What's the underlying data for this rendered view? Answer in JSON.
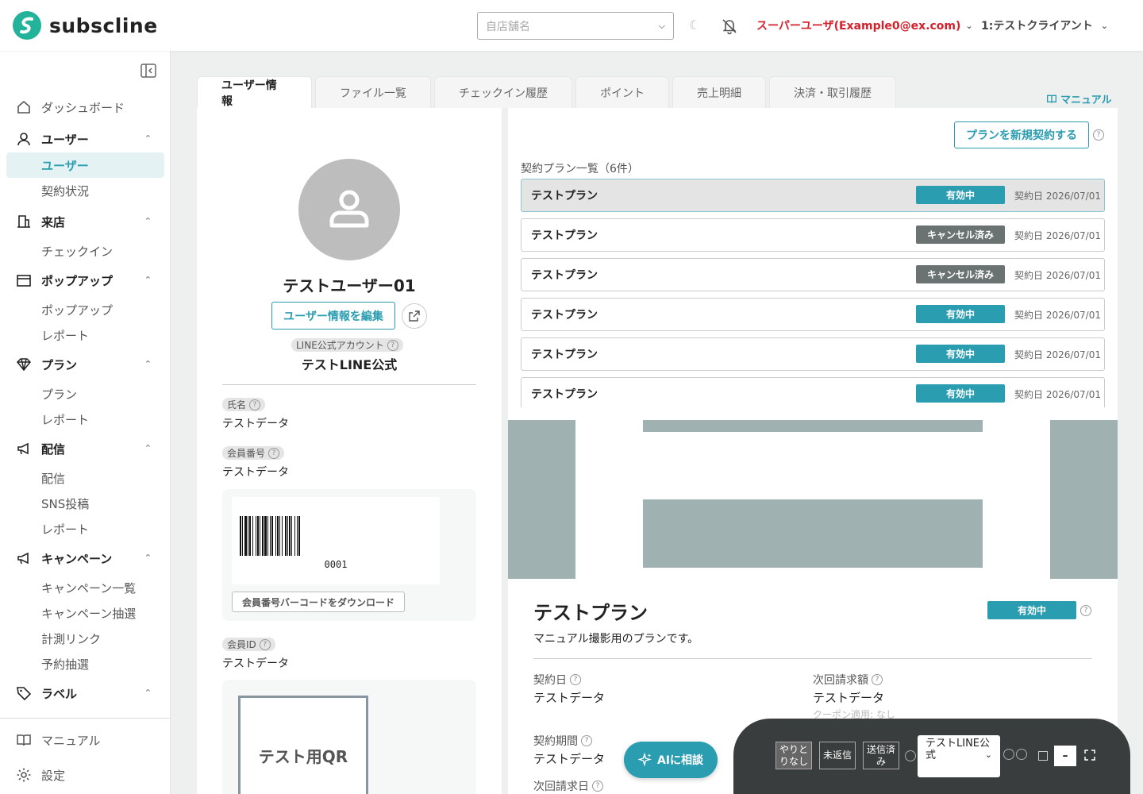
{
  "header": {
    "logo_text": "subscline",
    "store_placeholder": "自店舗名",
    "user_label": "スーパーユーザ(Example0@ex.com)",
    "client_label": "1:テストクライアント"
  },
  "sidebar": {
    "dashboard": "ダッシュボード",
    "groups": {
      "user": {
        "label": "ユーザー",
        "items": [
          "ユーザー",
          "契約状況"
        ]
      },
      "visit": {
        "label": "来店",
        "items": [
          "チェックイン"
        ]
      },
      "popup": {
        "label": "ポップアップ",
        "items": [
          "ポップアップ",
          "レポート"
        ]
      },
      "plan": {
        "label": "プラン",
        "items": [
          "プラン",
          "レポート"
        ]
      },
      "delivery": {
        "label": "配信",
        "items": [
          "配信",
          "SNS投稿",
          "レポート"
        ]
      },
      "campaign": {
        "label": "キャンペーン",
        "items": [
          "キャンペーン一覧",
          "キャンペーン抽選",
          "計測リンク",
          "予約抽選"
        ]
      },
      "label": {
        "label": "ラベル"
      }
    },
    "manual": "マニュアル",
    "settings": "設定"
  },
  "tabs": [
    "ユーザー情報",
    "ファイル一覧",
    "チェックイン履歴",
    "ポイント",
    "売上明細",
    "決済・取引履歴"
  ],
  "manual_link": "マニュアル",
  "profile": {
    "name": "テストユーザー01",
    "edit_button": "ユーザー情報を編集",
    "line_tag": "LINE公式アカウント",
    "line_name": "テストLINE公式",
    "fields": {
      "name_label": "氏名",
      "name_value": "テストデータ",
      "member_no_label": "会員番号",
      "member_no_value": "テストデータ",
      "member_id_label": "会員ID",
      "member_id_value": "テストデータ"
    },
    "barcode_number": "0001",
    "barcode_download": "会員番号バーコードをダウンロード",
    "qr_label": "テスト用QR"
  },
  "plans": {
    "new_button": "プランを新規契約する",
    "list_title": "契約プラン一覧（6件）",
    "rows": [
      {
        "name": "テストプラン",
        "status": "有効中",
        "date": "契約日 2026/07/01"
      },
      {
        "name": "テストプラン",
        "status": "キャンセル済み",
        "date": "契約日 2026/07/01"
      },
      {
        "name": "テストプラン",
        "status": "キャンセル済み",
        "date": "契約日 2026/07/01"
      },
      {
        "name": "テストプラン",
        "status": "有効中",
        "date": "契約日 2026/07/01"
      },
      {
        "name": "テストプラン",
        "status": "有効中",
        "date": "契約日 2026/07/01"
      },
      {
        "name": "テストプラン",
        "status": "有効中",
        "date": "契約日 2026/07/01"
      }
    ],
    "status_colors": {
      "active": "#2a9db0",
      "cancelled": "#6a7272"
    }
  },
  "detail": {
    "title": "テストプラン",
    "status": "有効中",
    "description": "マニュアル撮影用のプランです。",
    "contract_date_label": "契約日",
    "contract_date_value": "テストデータ",
    "next_amount_label": "次回請求額",
    "next_amount_value": "テストデータ",
    "coupon": "クーポン適用: なし",
    "period_label": "契約期間",
    "period_value": "テストデータ",
    "next_date_label": "次回請求日"
  },
  "ai_button": "AIに相談",
  "chat": {
    "chip1": "やりとりなし",
    "chip2": "未返信",
    "chip3": "送信済み",
    "account_select": "テストLINE公式",
    "minimize": "–"
  },
  "accent_color": "#2a9db0"
}
